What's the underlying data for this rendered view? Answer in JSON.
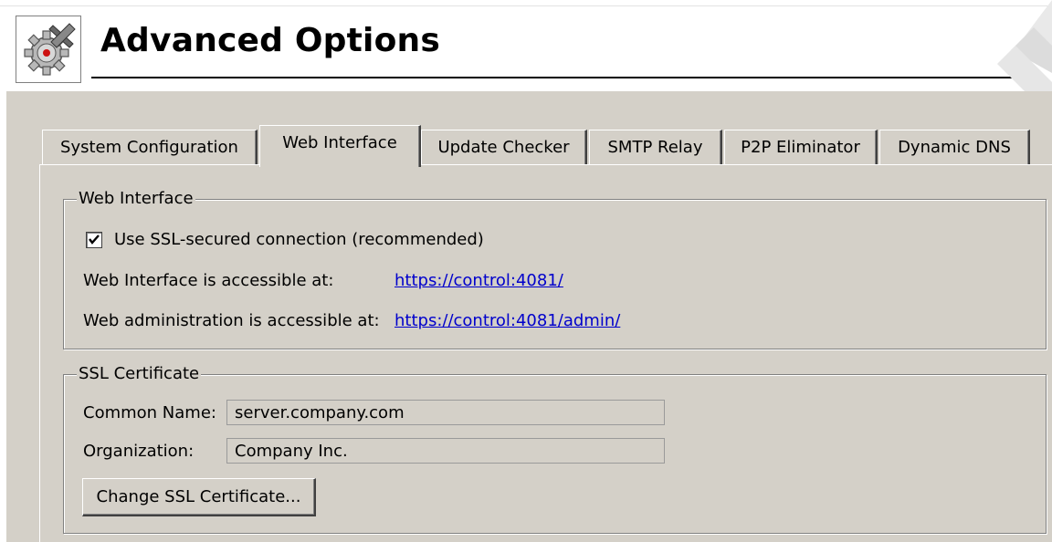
{
  "header": {
    "title": "Advanced Options",
    "icon": "gear-tools-icon",
    "corner_logo": "kerio-logo-icon"
  },
  "tabs": [
    {
      "label": "System Configuration",
      "active": false
    },
    {
      "label": "Web Interface",
      "active": true
    },
    {
      "label": "Update Checker",
      "active": false
    },
    {
      "label": "SMTP Relay",
      "active": false
    },
    {
      "label": "P2P Eliminator",
      "active": false
    },
    {
      "label": "Dynamic DNS",
      "active": false
    }
  ],
  "web_interface": {
    "group_label": "Web Interface",
    "ssl_checkbox_label": "Use SSL-secured connection (recommended)",
    "ssl_checked": true,
    "web_access_label": "Web Interface is accessible at:",
    "web_access_link": "https://control:4081/",
    "admin_access_label": "Web administration is accessible at:",
    "admin_access_link": "https://control:4081/admin/"
  },
  "ssl_certificate": {
    "group_label": "SSL Certificate",
    "common_name_label": "Common Name:",
    "common_name_value": "server.company.com",
    "organization_label": "Organization:",
    "organization_value": "Company Inc.",
    "change_button": "Change SSL Certificate..."
  }
}
